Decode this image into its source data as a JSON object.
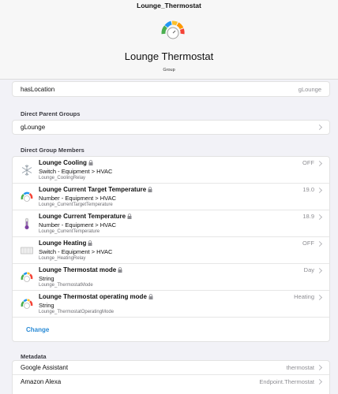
{
  "header": {
    "window_title": "Lounge_Thermostat",
    "title": "Lounge Thermostat",
    "subtitle": "Group"
  },
  "location_row": {
    "label": "hasLocation",
    "value": "gLounge"
  },
  "parent_groups": {
    "title": "Direct Parent Groups",
    "items": [
      {
        "label": "gLounge"
      }
    ]
  },
  "members": {
    "title": "Direct Group Members",
    "items": [
      {
        "name": "Lounge Cooling",
        "type": "Switch - Equipment > HVAC",
        "item": "Lounge_CoolingRelay",
        "value": "OFF",
        "icon": "snowflake-icon"
      },
      {
        "name": "Lounge Current Target Temperature",
        "type": "Number - Equipment > HVAC",
        "item": "Lounge_CurrentTargetTemperature",
        "value": "19.0",
        "icon": "gauge-icon"
      },
      {
        "name": "Lounge Current Temperature",
        "type": "Number - Equipment > HVAC",
        "item": "Lounge_CurrentTemperature",
        "value": "18.9",
        "icon": "thermometer-icon"
      },
      {
        "name": "Lounge Heating",
        "type": "Switch - Equipment > HVAC",
        "item": "Lounge_HeatingRelay",
        "value": "OFF",
        "icon": "radiator-icon"
      },
      {
        "name": "Lounge Thermostat mode",
        "type": "String",
        "item": "Lounge_ThermostatMode",
        "value": "Day",
        "icon": "gauge-icon"
      },
      {
        "name": "Lounge Thermostat operating mode",
        "type": "String",
        "item": "Lounge_ThermostatOperatingMode",
        "value": "Heating",
        "icon": "gauge-icon"
      }
    ],
    "change_label": "Change"
  },
  "metadata": {
    "title": "Metadata",
    "items": [
      {
        "label": "Google Assistant",
        "value": "thermostat"
      },
      {
        "label": "Amazon Alexa",
        "value": "Endpoint.Thermostat"
      }
    ]
  }
}
